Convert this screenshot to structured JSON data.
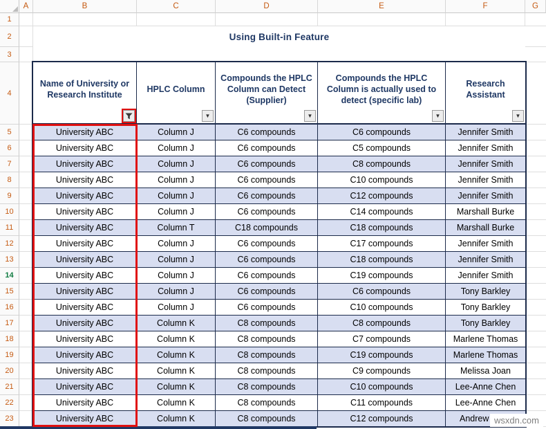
{
  "title": "Using Built-in Feature",
  "watermark": "wsxdn.com",
  "sheet": {
    "column_letters": [
      "A",
      "B",
      "C",
      "D",
      "E",
      "F",
      "G"
    ],
    "row_numbers": [
      "1",
      "2",
      "3",
      "4",
      "5",
      "6",
      "7",
      "8",
      "9",
      "10",
      "11",
      "12",
      "13",
      "14",
      "15",
      "16",
      "17",
      "18",
      "19",
      "20",
      "21",
      "22",
      "23"
    ],
    "active_row": "14"
  },
  "table": {
    "columns": [
      {
        "label": "Name of University or Research Institute",
        "filter": "funnel"
      },
      {
        "label": "HPLC Column",
        "filter": "arrow"
      },
      {
        "label": "Compounds the HPLC Column can Detect (Supplier)",
        "filter": "arrow"
      },
      {
        "label": "Compounds the HPLC Column is actually used to detect (specific lab)",
        "filter": "arrow"
      },
      {
        "label": "Research Assistant",
        "filter": "arrow"
      }
    ],
    "rows": [
      [
        "University ABC",
        "Column J",
        "C6 compounds",
        "C6 compounds",
        "Jennifer Smith"
      ],
      [
        "University ABC",
        "Column J",
        "C6 compounds",
        "C5 compounds",
        "Jennifer Smith"
      ],
      [
        "University ABC",
        "Column J",
        "C6 compounds",
        "C8 compounds",
        "Jennifer Smith"
      ],
      [
        "University ABC",
        "Column J",
        "C6 compounds",
        "C10 compounds",
        "Jennifer Smith"
      ],
      [
        "University ABC",
        "Column J",
        "C6 compounds",
        "C12 compounds",
        "Jennifer Smith"
      ],
      [
        "University ABC",
        "Column J",
        "C6 compounds",
        "C14 compounds",
        "Marshall Burke"
      ],
      [
        "University ABC",
        "Column T",
        "C18 compounds",
        "C18 compounds",
        "Marshall Burke"
      ],
      [
        "University ABC",
        "Column J",
        "C6 compounds",
        "C17 compounds",
        "Jennifer Smith"
      ],
      [
        "University ABC",
        "Column J",
        "C6 compounds",
        "C18 compounds",
        "Jennifer Smith"
      ],
      [
        "University ABC",
        "Column J",
        "C6 compounds",
        "C19 compounds",
        "Jennifer Smith"
      ],
      [
        "University ABC",
        "Column J",
        "C6 compounds",
        "C6 compounds",
        "Tony Barkley"
      ],
      [
        "University ABC",
        "Column J",
        "C6 compounds",
        "C10 compounds",
        "Tony Barkley"
      ],
      [
        "University ABC",
        "Column K",
        "C8 compounds",
        "C8 compounds",
        "Tony Barkley"
      ],
      [
        "University ABC",
        "Column K",
        "C8 compounds",
        "C7 compounds",
        "Marlene Thomas"
      ],
      [
        "University ABC",
        "Column K",
        "C8 compounds",
        "C19 compounds",
        "Marlene Thomas"
      ],
      [
        "University ABC",
        "Column K",
        "C8 compounds",
        "C9 compounds",
        "Melissa Joan"
      ],
      [
        "University ABC",
        "Column K",
        "C8 compounds",
        "C10 compounds",
        "Lee-Anne Chen"
      ],
      [
        "University ABC",
        "Column K",
        "C8 compounds",
        "C11 compounds",
        "Lee-Anne Chen"
      ],
      [
        "University ABC",
        "Column K",
        "C8 compounds",
        "C12 compounds",
        "Andrew Willis"
      ]
    ]
  },
  "colors": {
    "band": "#D8DEF1",
    "table_border": "#1B2A4A",
    "header_text": "#1F3864",
    "title_text": "#1F3864",
    "red_highlight": "#E01010",
    "row_header_text": "#C55A11",
    "active_row_text": "#107C41",
    "watermark_text": "#7F7F7F",
    "bottom_bar": "#203864"
  }
}
